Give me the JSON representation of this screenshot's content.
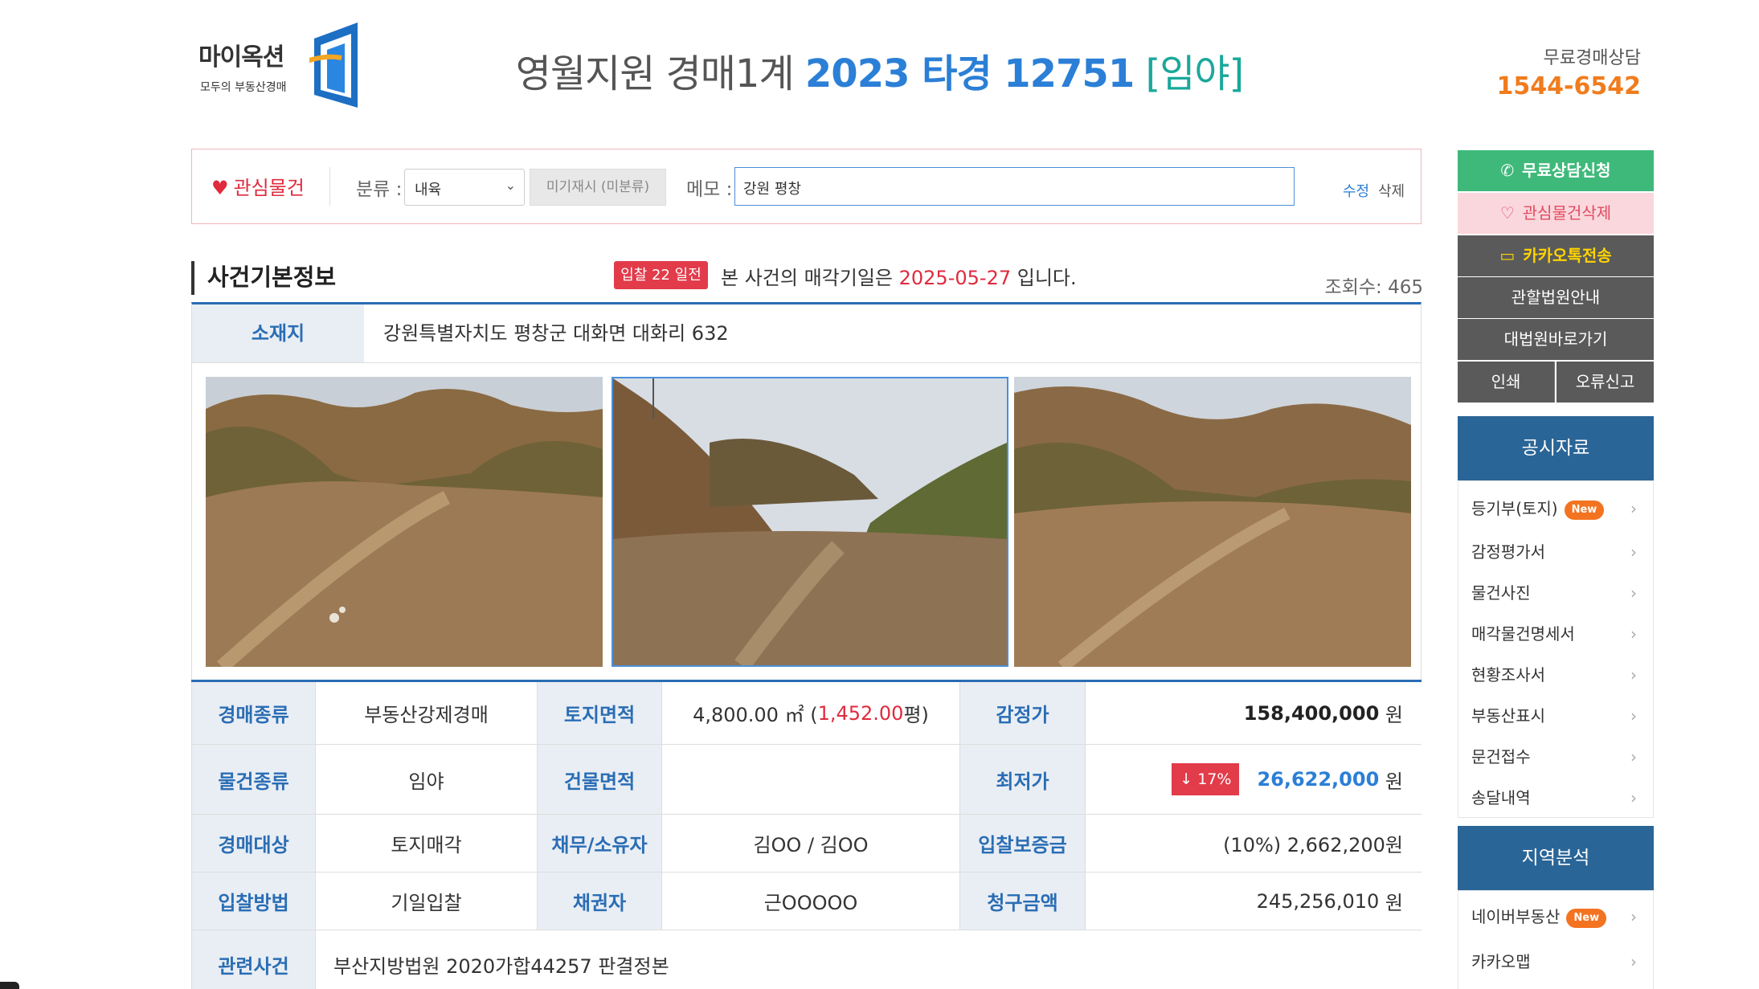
{
  "logo": {
    "name": "마이옥션",
    "tagline": "모두의 부동산경매"
  },
  "title": {
    "court": "영월지원 경매1계",
    "case": "2023 타경 12751",
    "kind": "[임야]"
  },
  "hotline": {
    "label": "무료경매상담",
    "number": "1544-6542"
  },
  "memobar": {
    "favorite": "관심물건",
    "category_label": "분류 :",
    "category_value": "내육",
    "unassigned": "미기재시 (미분류)",
    "memo_label": "메모 :",
    "memo_value": "강원 평창",
    "edit": "수정",
    "delete": "삭제"
  },
  "section": {
    "title": "사건기본정보",
    "dday": "입찰 22 일전",
    "sale_prefix": "본 사건의 매각기일은",
    "sale_date": "2025-05-27",
    "sale_suffix": "입니다.",
    "views": "조회수: 465"
  },
  "location": {
    "label": "소재지",
    "value": "강원특별자치도 평창군 대화면 대화리 632"
  },
  "details": {
    "auction_type_label": "경매종류",
    "auction_type": "부동산강제경매",
    "land_area_label": "토지면적",
    "land_area_m2": "4,800.00 ㎡ (",
    "land_area_py": "1,452.00",
    "land_area_unit": "평)",
    "appraisal_label": "감정가",
    "appraisal": "158,400,000",
    "won": "원",
    "item_type_label": "물건종류",
    "item_type": "임야",
    "building_area_label": "건물면적",
    "building_area": "",
    "min_price_label": "최저가",
    "discount": "↓ 17%",
    "min_price": "26,622,000",
    "target_label": "경매대상",
    "target": "토지매각",
    "debtor_label": "채무/소유자",
    "debtor": "김OO / 김OO",
    "deposit_label": "입찰보증금",
    "deposit": "(10%) 2,662,200원",
    "method_label": "입찰방법",
    "method": "기일입찰",
    "creditor_label": "채권자",
    "creditor": "근OOOOO",
    "claim_label": "청구금액",
    "claim": "245,256,010",
    "related_label": "관련사건",
    "related": "부산지방법원 2020가합44257 판결정본"
  },
  "sidebar": {
    "consult": "무료상담신청",
    "fav_delete": "관심물건삭제",
    "kakao": "카카오톡전송",
    "court_info": "관할법원안내",
    "supreme": "대법원바로가기",
    "print": "인쇄",
    "report": "오류신고",
    "public_title": "공시자료",
    "public_items": [
      "등기부(토지)",
      "감정평가서",
      "물건사진",
      "매각물건명세서",
      "현황조사서",
      "부동산표시",
      "문건접수",
      "송달내역"
    ],
    "new_badge": "New",
    "region_title": "지역분석",
    "region_items": [
      "네이버부동산",
      "카카오맵"
    ]
  },
  "colors": {
    "brand_blue": "#2a6db4",
    "accent_red": "#e02a3e",
    "green": "#3fb97a",
    "orange": "#f37321"
  },
  "icons": [
    "heart-icon",
    "chevron-down-icon",
    "phone-icon",
    "heart-outline-icon",
    "chat-icon",
    "chevron-right-icon"
  ]
}
